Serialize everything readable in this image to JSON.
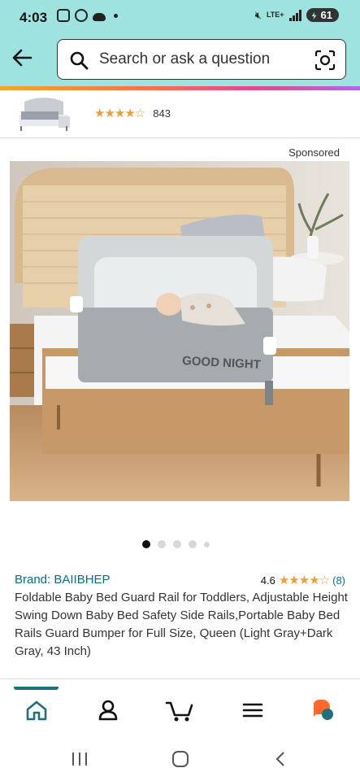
{
  "status_bar": {
    "time": "4:03",
    "network": "LTE+",
    "battery": "61"
  },
  "search": {
    "placeholder": "Search or ask a question"
  },
  "sticky_product": {
    "stars": "★★★★☆",
    "review_count": "843"
  },
  "sponsored_label": "Sponsored",
  "image_overlay_text": "GOOD NIGHT",
  "carousel": {
    "total": 5,
    "active_index": 0
  },
  "product": {
    "brand": "Brand: BAIIBHEP",
    "rating_value": "4.6",
    "rating_stars": "★★★★☆",
    "rating_count": "(8)",
    "title": "Foldable Baby Bed Guard Rail for Toddlers, Adjustable Height Swing Down Baby Bed Safety Side Rails,Portable Baby Bed Rails Guard Bumper for Full Size, Queen (Light Gray+Dark Gray, 43 Inch)"
  },
  "bottom_nav": {
    "items": [
      "home-icon",
      "account-icon",
      "cart-icon",
      "menu-icon",
      "rufus-icon"
    ],
    "active": "home-icon"
  },
  "colors": {
    "header_bg": "#9ee3e0",
    "link": "#007185",
    "star": "#f19e39",
    "accent_orange": "#ff6a2a",
    "accent_teal": "#1f6f7f"
  }
}
